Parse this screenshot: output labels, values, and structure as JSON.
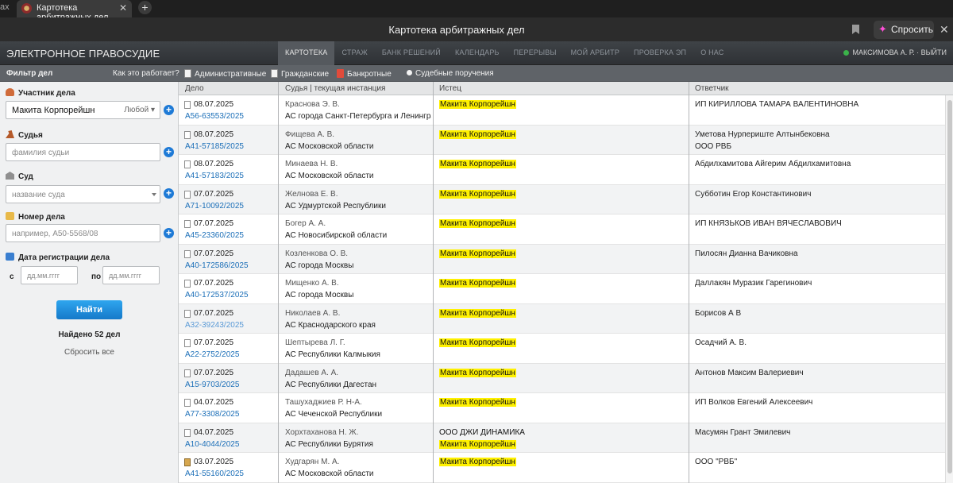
{
  "browser": {
    "prev_tab_label": "ax",
    "tab_title": "Картотека арбитражных дел",
    "page_title": "Картотека арбитражных дел",
    "ask_label": "Спросить"
  },
  "site": {
    "logo": "ЭЛЕКТРОННОЕ ПРАВОСУДИЕ",
    "nav": [
      "КАРТОТЕКА",
      "СТРАЖ",
      "БАНК РЕШЕНИЙ",
      "КАЛЕНДАРЬ",
      "ПЕРЕРЫВЫ",
      "МОЙ АРБИТР",
      "ПРОВЕРКА ЭП",
      "О НАС"
    ],
    "user_label": "МАКСИМОВА А. Р. · ВЫЙТИ"
  },
  "filterbar": {
    "title": "Фильтр дел",
    "how_link": "Как это работает?",
    "categories": [
      "Административные",
      "Гражданские",
      "Банкротные",
      "Судебные поручения"
    ]
  },
  "sidebar": {
    "participant_label": "Участник дела",
    "participant_value": "Макита Корпорейшн",
    "participant_role": "Любой",
    "judge_label": "Судья",
    "judge_placeholder": "фамилия судьи",
    "court_label": "Суд",
    "court_placeholder": "название суда",
    "case_number_label": "Номер дела",
    "case_number_placeholder": "например, А50-5568/08",
    "reg_date_label": "Дата регистрации дела",
    "date_from_label": "с",
    "date_to_label": "по",
    "date_placeholder": "дд.мм.гггг",
    "find_button": "Найти",
    "found_text": "Найдено 52 дел",
    "reset_link": "Сбросить все"
  },
  "table": {
    "headers": [
      "Дело",
      "Судья | текущая инстанция",
      "Истец",
      "Ответчик"
    ],
    "rows": [
      {
        "date": "08.07.2025",
        "number": "А56-63553/2025",
        "judge": "Краснова Э. В.",
        "court": "АС города Санкт-Петербурга и Ленинградс",
        "plaintiff1": "Макита Корпорейшн",
        "plaintiff2": "",
        "def1": "ИП КИРИЛЛОВА ТАМАРА ВАЛЕНТИНОВНА",
        "def2": ""
      },
      {
        "date": "08.07.2025",
        "number": "А41-57185/2025",
        "judge": "Фищева А. В.",
        "court": "АС Московской области",
        "plaintiff1": "Макита Корпорейшн",
        "plaintiff2": "",
        "def1": "Уметова Нурпериште Алтынбековна",
        "def2": "ООО РВБ"
      },
      {
        "date": "08.07.2025",
        "number": "А41-57183/2025",
        "judge": "Минаева Н. В.",
        "court": "АС Московской области",
        "plaintiff1": "Макита Корпорейшн",
        "plaintiff2": "",
        "def1": "Абдилхамитова Айгерим Абдилхамитовна",
        "def2": ""
      },
      {
        "date": "07.07.2025",
        "number": "А71-10092/2025",
        "judge": "Желнова Е. В.",
        "court": "АС Удмуртской Республики",
        "plaintiff1": "Макита Корпорейшн",
        "plaintiff2": "",
        "def1": "Субботин Егор Константинович",
        "def2": ""
      },
      {
        "date": "07.07.2025",
        "number": "А45-23360/2025",
        "judge": "Богер А. А.",
        "court": "АС Новосибирской области",
        "plaintiff1": "Макита Корпорейшн",
        "plaintiff2": "",
        "def1": "ИП КНЯЗЬКОВ ИВАН ВЯЧЕСЛАВОВИЧ",
        "def2": ""
      },
      {
        "date": "07.07.2025",
        "number": "А40-172586/2025",
        "judge": "Козленкова О. В.",
        "court": "АС города Москвы",
        "plaintiff1": "Макита Корпорейшн",
        "plaintiff2": "",
        "def1": "Пилосян Дианна Вачиковна",
        "def2": ""
      },
      {
        "date": "07.07.2025",
        "number": "А40-172537/2025",
        "judge": "Мищенко А. В.",
        "court": "АС города Москвы",
        "plaintiff1": "Макита Корпорейшн",
        "plaintiff2": "",
        "def1": "Даллакян Муразик Гарегинович",
        "def2": ""
      },
      {
        "date": "07.07.2025",
        "number": "А32-39243/2025",
        "judge": "Николаев А. В.",
        "court": "АС Краснодарского края",
        "plaintiff1": "Макита Корпорейшн",
        "plaintiff2": "",
        "def1": "Борисов А В",
        "def2": ""
      },
      {
        "date": "07.07.2025",
        "number": "А22-2752/2025",
        "judge": "Шептырева Л. Г.",
        "court": "АС Республики Калмыкия",
        "plaintiff1": "Макита Корпорейшн",
        "plaintiff2": "",
        "def1": "Осадчий А. В.",
        "def2": ""
      },
      {
        "date": "07.07.2025",
        "number": "А15-9703/2025",
        "judge": "Дадашев А. А.",
        "court": "АС Республики Дагестан",
        "plaintiff1": "Макита Корпорейшн",
        "plaintiff2": "",
        "def1": "Антонов Максим Валериевич",
        "def2": ""
      },
      {
        "date": "04.07.2025",
        "number": "А77-3308/2025",
        "judge": "Ташухаджиев Р. Н-А.",
        "court": "АС Чеченской Республики",
        "plaintiff1": "Макита Корпорейшн",
        "plaintiff2": "",
        "def1": "ИП Волков Евгений Алексеевич",
        "def2": ""
      },
      {
        "date": "04.07.2025",
        "number": "А10-4044/2025",
        "judge": "Хорхтаханова Н. Ж.",
        "court": "АС Республики Бурятия",
        "plaintiff1": "ООО ДЖИ ДИНАМИКА",
        "plaintiff2": "Макита Корпорейшн",
        "def1": "Масумян Грант Эмилевич",
        "def2": ""
      },
      {
        "date": "03.07.2025",
        "number": "А41-55160/2025",
        "judge": "Худгарян М. А.",
        "court": "АС Московской области",
        "plaintiff1": "Макита Корпорейшн",
        "plaintiff2": "",
        "def1": "ООО \"РВБ\"",
        "def2": ""
      }
    ]
  }
}
